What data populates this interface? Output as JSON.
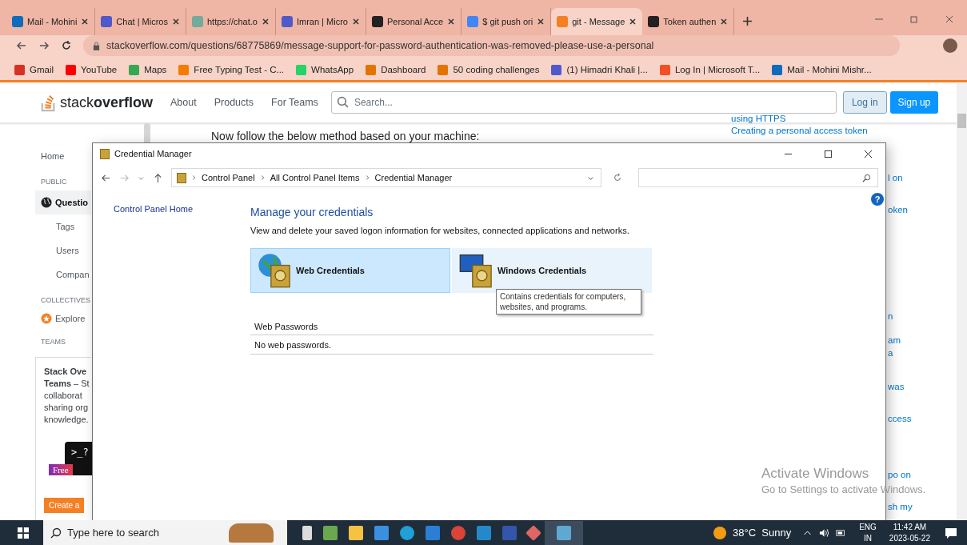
{
  "browser": {
    "tabs": [
      {
        "title": "Mail - Mohini",
        "selected": false
      },
      {
        "title": "Chat | Micros",
        "selected": false
      },
      {
        "title": "https://chat.o",
        "selected": false
      },
      {
        "title": "Imran | Micro",
        "selected": false
      },
      {
        "title": "Personal Acce",
        "selected": false
      },
      {
        "title": "$ git push ori",
        "selected": false
      },
      {
        "title": "git - Message",
        "selected": true
      },
      {
        "title": "Token authen",
        "selected": false
      }
    ],
    "url": "stackoverflow.com/questions/68775869/message-support-for-password-authentication-was-removed-please-use-a-personal",
    "bookmarks": [
      {
        "label": "Gmail",
        "color": "#d93025"
      },
      {
        "label": "YouTube",
        "color": "#ff0000"
      },
      {
        "label": "Maps",
        "color": "#34a853"
      },
      {
        "label": "Free Typing Test - C...",
        "color": "#f57c00"
      },
      {
        "label": "WhatsApp",
        "color": "#25d366"
      },
      {
        "label": "Dashboard",
        "color": "#e37400"
      },
      {
        "label": "50 coding challenges",
        "color": "#e37400"
      },
      {
        "label": "(1) Himadri Khali |...",
        "color": "#5059c9"
      },
      {
        "label": "Log In | Microsoft T...",
        "color": "#f25022"
      },
      {
        "label": "Mail - Mohini Mishr...",
        "color": "#0f6cbd"
      }
    ]
  },
  "site": {
    "logo": "stack**overflow**",
    "nav": [
      "About",
      "Products",
      "For Teams"
    ],
    "search_placeholder": "Search...",
    "login": "Log in",
    "signup": "Sign up",
    "sidebar": [
      {
        "kind": "link",
        "label": "Home",
        "selected": false
      },
      {
        "kind": "heading",
        "label": "PUBLIC",
        "selected": false
      },
      {
        "kind": "link",
        "label": "Questio",
        "selected": true
      },
      {
        "kind": "sublink",
        "label": "Tags",
        "selected": false
      },
      {
        "kind": "sublink",
        "label": "Users",
        "selected": false
      },
      {
        "kind": "sublink",
        "label": "Compan",
        "selected": false
      },
      {
        "kind": "heading",
        "label": "COLLECTIVES",
        "selected": false
      },
      {
        "kind": "explore",
        "label": "Explore",
        "selected": false
      },
      {
        "kind": "heading",
        "label": "TEAMS",
        "selected": false
      }
    ],
    "teams_card": {
      "lines": [
        "**Stack Ove**",
        "**Teams** – St",
        "collaborat",
        "sharing org",
        "knowledge."
      ],
      "badge": "Free",
      "prompt": ">_?",
      "button": "Create a"
    },
    "body_text": "Now follow the below method based on your machine:",
    "related": [
      "using HTTPS",
      "Creating a personal access token",
      "l on",
      "oken",
      "n",
      "am",
      "a",
      "was",
      "ccess",
      "po on",
      "sh my"
    ]
  },
  "window": {
    "title": "Credential Manager",
    "breadcrumb": [
      "Control Panel",
      "All Control Panel Items",
      "Credential Manager"
    ],
    "side_link": "Control Panel Home",
    "heading": "Manage your credentials",
    "description": "View and delete your saved logon information for websites, connected applications and networks.",
    "tiles": [
      {
        "label": "Web Credentials",
        "selected": true
      },
      {
        "label": "Windows Credentials",
        "selected": false
      }
    ],
    "tooltip": "Contains credentials for computers, websites, and programs.",
    "section": "Web Passwords",
    "empty": "No web passwords.",
    "help": "?"
  },
  "activation": {
    "title": "Activate Windows",
    "subtitle": "Go to Settings to activate Windows."
  },
  "taskbar": {
    "search_placeholder": "Type here to search",
    "weather": "38°C  Sunny",
    "lang": [
      "ENG",
      "IN"
    ],
    "time": "11:42 AM",
    "date": "2023-05-22"
  }
}
